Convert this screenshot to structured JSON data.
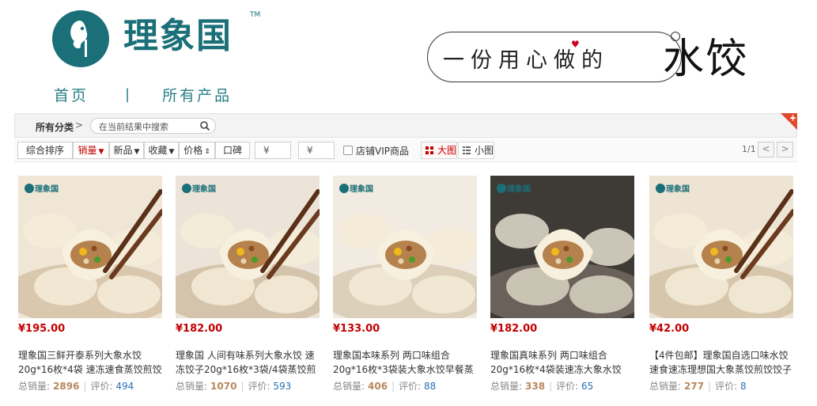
{
  "brand": {
    "name": "理象国",
    "tm": "TM"
  },
  "nav": {
    "home": "首页",
    "sep": "|",
    "all_products": "所有产品"
  },
  "slogan": {
    "text": "一份用心做的",
    "big": "水饺"
  },
  "category_bar": {
    "all_label": "所有分类",
    "chev": ">",
    "search_placeholder": "在当前结果中搜索"
  },
  "filters": {
    "sort_general": "综合排序",
    "sort_sales": "销量",
    "sort_new": "新品",
    "sort_fav": "收藏",
    "sort_price": "价格",
    "sort_reputation": "口碑",
    "price_min": "¥",
    "price_max": "¥",
    "price_dash": "-",
    "vip_label": "店铺VIP商品",
    "view_large": "大图",
    "view_small": "小图",
    "page": "1/1",
    "prev": "<",
    "next": ">"
  },
  "labels": {
    "sold": "总销量:",
    "reviews": "评价:",
    "bar": "|",
    "photo_logo": "理象国"
  },
  "products": [
    {
      "price": "¥195.00",
      "title": "理象国三鲜开泰系列大象水饺20g*16枚*4袋 速冻速食蒸饺煎饺",
      "sold": "2896",
      "reviews": "494"
    },
    {
      "price": "¥182.00",
      "title": "理象国 人间有味系列大象水饺 速冻饺子20g*16枚*3袋/4袋蒸饺煎",
      "sold": "1070",
      "reviews": "593"
    },
    {
      "price": "¥133.00",
      "title": "理象国本味系列 两口味组合20g*16枚*3袋装大象水饺早餐蒸",
      "sold": "406",
      "reviews": "88"
    },
    {
      "price": "¥182.00",
      "title": "理象国真味系列 两口味组合20g*16枚*4袋装速冻大象水饺",
      "sold": "338",
      "reviews": "65"
    },
    {
      "price": "¥42.00",
      "title": "【4件包邮】理象国自选口味水饺速食速冻理想国大象蒸饺煎饺饺子",
      "sold": "277",
      "reviews": "8"
    }
  ],
  "colors": {
    "brand": "#1a6f78",
    "price": "#c40000",
    "link": "#2a6fb5",
    "sold": "#b8875c"
  }
}
